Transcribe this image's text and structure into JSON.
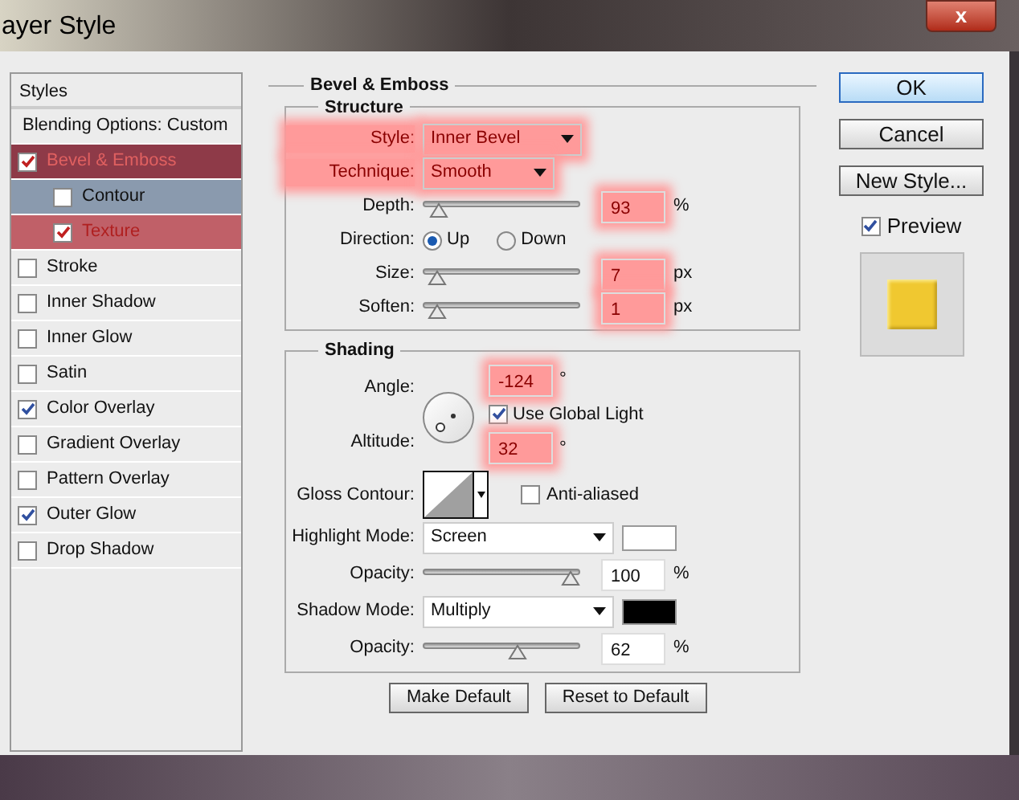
{
  "window": {
    "title": "ayer Style",
    "close_label": "x"
  },
  "styles_panel": {
    "header": "Styles",
    "items": [
      {
        "label": "Blending Options: Custom",
        "kind": "header",
        "selected": false,
        "highlighted": false
      },
      {
        "label": "Bevel & Emboss",
        "kind": "effect",
        "checked": true,
        "selected": true,
        "highlighted": true,
        "children": [
          {
            "label": "Contour",
            "checked": false,
            "selected": false,
            "highlighted": false
          },
          {
            "label": "Texture",
            "checked": true,
            "selected": false,
            "highlighted": true
          }
        ]
      },
      {
        "label": "Stroke",
        "kind": "effect",
        "checked": false,
        "selected": false,
        "highlighted": false
      },
      {
        "label": "Inner Shadow",
        "kind": "effect",
        "checked": false,
        "selected": false,
        "highlighted": false
      },
      {
        "label": "Inner Glow",
        "kind": "effect",
        "checked": false,
        "selected": false,
        "highlighted": false
      },
      {
        "label": "Satin",
        "kind": "effect",
        "checked": false,
        "selected": false,
        "highlighted": false
      },
      {
        "label": "Color Overlay",
        "kind": "effect",
        "checked": true,
        "selected": false,
        "highlighted": false
      },
      {
        "label": "Gradient Overlay",
        "kind": "effect",
        "checked": false,
        "selected": false,
        "highlighted": false
      },
      {
        "label": "Pattern Overlay",
        "kind": "effect",
        "checked": false,
        "selected": false,
        "highlighted": false
      },
      {
        "label": "Outer Glow",
        "kind": "effect",
        "checked": true,
        "selected": false,
        "highlighted": false
      },
      {
        "label": "Drop Shadow",
        "kind": "effect",
        "checked": false,
        "selected": false,
        "highlighted": false
      }
    ]
  },
  "settings": {
    "title": "Bevel & Emboss",
    "structure": {
      "title": "Structure",
      "rows": [
        {
          "kind": "select",
          "label": "Style:",
          "value": "Inner Bevel",
          "highlighted": true
        },
        {
          "kind": "select",
          "label": "Technique:",
          "value": "Smooth",
          "highlighted": true
        },
        {
          "kind": "slider",
          "label": "Depth:",
          "level": 0.05,
          "value": "93",
          "unit": "%",
          "highlighted": true
        },
        {
          "kind": "radio",
          "label": "Direction:",
          "options": [
            {
              "label": "Up",
              "selected": true
            },
            {
              "label": "Down",
              "selected": false
            }
          ]
        },
        {
          "kind": "slider",
          "label": "Size:",
          "level": 0.03,
          "value": "7",
          "unit": "px",
          "highlighted": true
        },
        {
          "kind": "slider",
          "label": "Soften:",
          "level": 0.03,
          "value": "1",
          "unit": "px",
          "highlighted": true
        }
      ]
    },
    "shading": {
      "title": "Shading",
      "angle": {
        "label": "Angle:",
        "value": "-124",
        "unit": "°",
        "highlighted": true
      },
      "use_global_light": {
        "label": "Use Global Light",
        "checked": true
      },
      "altitude": {
        "label": "Altitude:",
        "value": "32",
        "unit": "°",
        "highlighted": true
      },
      "gloss_contour": {
        "label": "Gloss Contour:"
      },
      "anti_aliased": {
        "label": "Anti-aliased",
        "checked": false
      },
      "rows": [
        {
          "kind": "mode",
          "label": "Highlight Mode:",
          "value": "Screen",
          "color": "#ffffff"
        },
        {
          "kind": "slider",
          "label": "Opacity:",
          "level": 1.0,
          "value": "100",
          "unit": "%"
        },
        {
          "kind": "mode",
          "label": "Shadow Mode:",
          "value": "Multiply",
          "color": "#000000"
        },
        {
          "kind": "slider",
          "label": "Opacity:",
          "level": 0.62,
          "value": "62",
          "unit": "%"
        }
      ]
    },
    "buttons": [
      "Make Default",
      "Reset to Default"
    ]
  },
  "actions": [
    {
      "label": "OK",
      "default": true
    },
    {
      "label": "Cancel",
      "default": false
    },
    {
      "label": "New Style...",
      "default": false
    }
  ],
  "preview": {
    "label": "Preview",
    "checked": true
  }
}
